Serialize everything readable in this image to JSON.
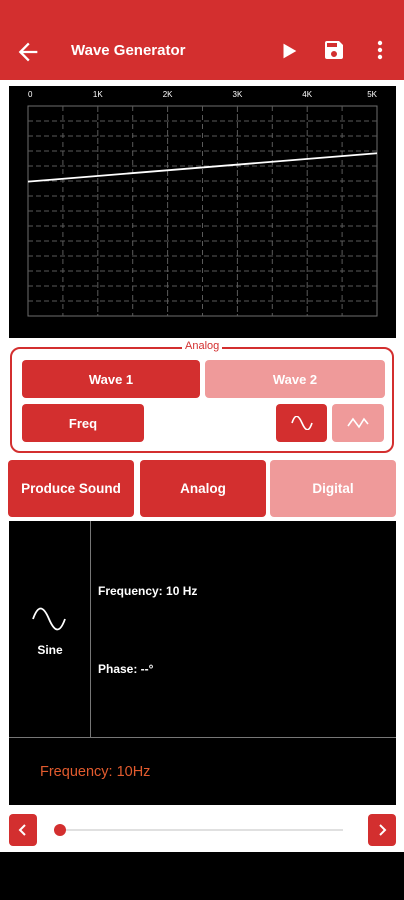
{
  "app": {
    "title": "Wave Generator",
    "accent_color": "#d32f2f",
    "accent_light_color": "#ef9a9a"
  },
  "toolbar": {
    "back_icon": "arrow-left-icon",
    "play_icon": "play-icon",
    "save_icon": "save-icon",
    "more_icon": "more-vert-icon"
  },
  "chart_data": {
    "type": "line",
    "title": "",
    "xlabel": "",
    "ylabel": "",
    "x_tick_labels": [
      "0",
      "1K",
      "2K",
      "3K",
      "4K",
      "5K"
    ],
    "xlim": [
      0,
      5000
    ],
    "ylim": [
      -1,
      1
    ],
    "grid": true,
    "series": [
      {
        "x": [
          0,
          5000
        ],
        "y": [
          0.28,
          0.55
        ]
      }
    ]
  },
  "analog_panel": {
    "legend": "Analog",
    "wave1_label": "Wave 1",
    "wave2_label": "Wave 2",
    "freq_label": "Freq",
    "sine_icon": "sine-wave-icon",
    "triangle_icon": "triangle-wave-icon"
  },
  "modes": {
    "produce_sound_label": "Produce Sound",
    "analog_label": "Analog",
    "digital_label": "Digital"
  },
  "info": {
    "wave_icon": "sine-wave-icon",
    "wave_name": "Sine",
    "frequency_text": "Frequency: 10 Hz",
    "phase_text": "Phase: --°",
    "status_text": "Frequency: 10Hz"
  },
  "slider": {
    "left_icon": "chevron-left-icon",
    "right_icon": "chevron-right-icon",
    "value_fraction": 0.0
  }
}
